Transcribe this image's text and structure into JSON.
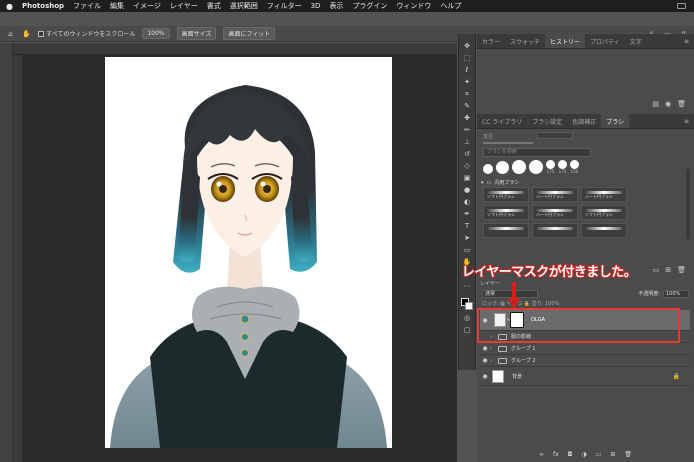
{
  "menubar": {
    "apple": "",
    "app": "Photoshop",
    "items": [
      "ファイル",
      "編集",
      "イメージ",
      "レイヤー",
      "書式",
      "選択範囲",
      "フィルター",
      "3D",
      "表示",
      "プラグイン",
      "ウィンドウ",
      "ヘルプ"
    ]
  },
  "options": {
    "scroll_all_label": "すべてのウィンドウをスクロール",
    "zoom_value": "100%",
    "fit_screen_label": "画面サイズ",
    "fill_screen_label": "画面にフィット"
  },
  "history_panel": {
    "tabs": [
      "カラー",
      "スウォッチ",
      "ヒストリー",
      "プロパティ",
      "文字"
    ],
    "active_tab": "ヒストリー"
  },
  "brush_panel": {
    "tabs": [
      "CC ライブラリ",
      "ブラシ設定",
      "色調補正",
      "ブラシ"
    ],
    "active_tab": "ブラシ",
    "size_label": "直径",
    "search_placeholder": "ブラシを検索",
    "presets": [
      "",
      "",
      "",
      "",
      "175",
      "175",
      "150"
    ],
    "group_name": "汎用ブラシ",
    "brushes": [
      "ソフト円ブラシ",
      "ハード円ブラシ",
      "ハード円ブラシ",
      "ソフト円ブラシ",
      "ハード円ブラシ",
      "ソフト円ブラシ",
      "",
      "",
      ""
    ]
  },
  "layers_panel": {
    "tab": "レイヤー",
    "blend_mode": "通常",
    "opacity_label": "不透明度:",
    "opacity_value": "100%",
    "lock_label": "ロック:",
    "fill_label": "塗り: 100%",
    "layers": [
      {
        "name": "OLGA",
        "type": "layer-mask",
        "selected": true
      },
      {
        "name": "服の影線",
        "type": "group"
      },
      {
        "name": "グループ 1",
        "type": "group"
      },
      {
        "name": "グループ 2",
        "type": "group"
      },
      {
        "name": "背景",
        "type": "background"
      }
    ]
  },
  "annotation": {
    "callout_text": "レイヤーマスクが付きました。",
    "highlight_color": "#e43b30"
  }
}
